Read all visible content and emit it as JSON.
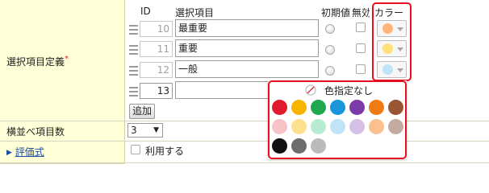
{
  "columns": {
    "id": "ID",
    "name": "選択項目",
    "initial": "初期値",
    "invalid": "無効",
    "color": "カラー"
  },
  "definition_label": "選択項目定義",
  "required_mark": "*",
  "items": [
    {
      "id": "10",
      "name": "最重要",
      "color": "#ffb57a"
    },
    {
      "id": "11",
      "name": "重要",
      "color": "#ffe07a"
    },
    {
      "id": "12",
      "name": "一般",
      "color": "#bfe3f7"
    },
    {
      "id": "13",
      "name": "",
      "color": null
    }
  ],
  "add_button": "追加",
  "sort_count": {
    "label": "横並べ項目数",
    "value": "3"
  },
  "formula": {
    "label": "評価式",
    "checkbox_label": "利用する"
  },
  "palette": {
    "no_color_label": "色指定なし",
    "rows": [
      [
        "#e01b2e",
        "#f7b500",
        "#1fa850",
        "#1a96db",
        "#7b3aa8",
        "#ef7b12",
        "#9a5532"
      ],
      [
        "#f7c3c8",
        "#ffe08c",
        "#b7ecd3",
        "#bfe3f7",
        "#d6c0e6",
        "#fcbf8e",
        "#c3aba0"
      ],
      [
        "#111111",
        "#6e6e6e",
        "#bbbbbb"
      ]
    ]
  },
  "highlight_color": "#e8101e"
}
